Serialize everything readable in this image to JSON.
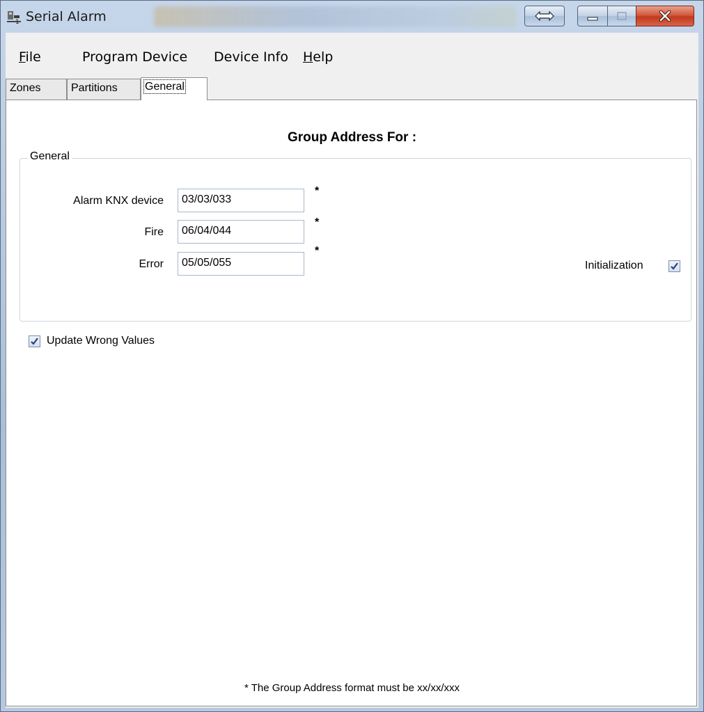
{
  "window": {
    "title": "Serial Alarm",
    "icon": "alarm-app-icon"
  },
  "menu": {
    "items": [
      {
        "label_underlined": "F",
        "label_rest": "ile"
      },
      {
        "label": "Program Device"
      },
      {
        "label": "Device Info"
      },
      {
        "label_underlined": "H",
        "label_rest": "elp"
      }
    ]
  },
  "tabs": [
    {
      "label": "Zones",
      "active": false
    },
    {
      "label": "Partitions",
      "active": false
    },
    {
      "label": "General",
      "active": true
    }
  ],
  "general_tab": {
    "heading": "Group Address For :",
    "group_title": "General",
    "fields": [
      {
        "label": "Alarm KNX device",
        "value": "03/03/033",
        "marker": "*"
      },
      {
        "label": "Fire",
        "value": "06/04/044",
        "marker": "*"
      },
      {
        "label": "Error",
        "value": "05/05/055",
        "marker": "*"
      }
    ],
    "initialization": {
      "label": "Initialization",
      "checked": true
    },
    "update_wrong_values": {
      "label": "Update Wrong Values",
      "checked": true
    },
    "footnote": "* The Group Address format must be xx/xx/xxx"
  },
  "colors": {
    "close_button": "#c23a1e",
    "tab_page_bg": "#ffffff",
    "client_bg": "#f0f0f0"
  }
}
